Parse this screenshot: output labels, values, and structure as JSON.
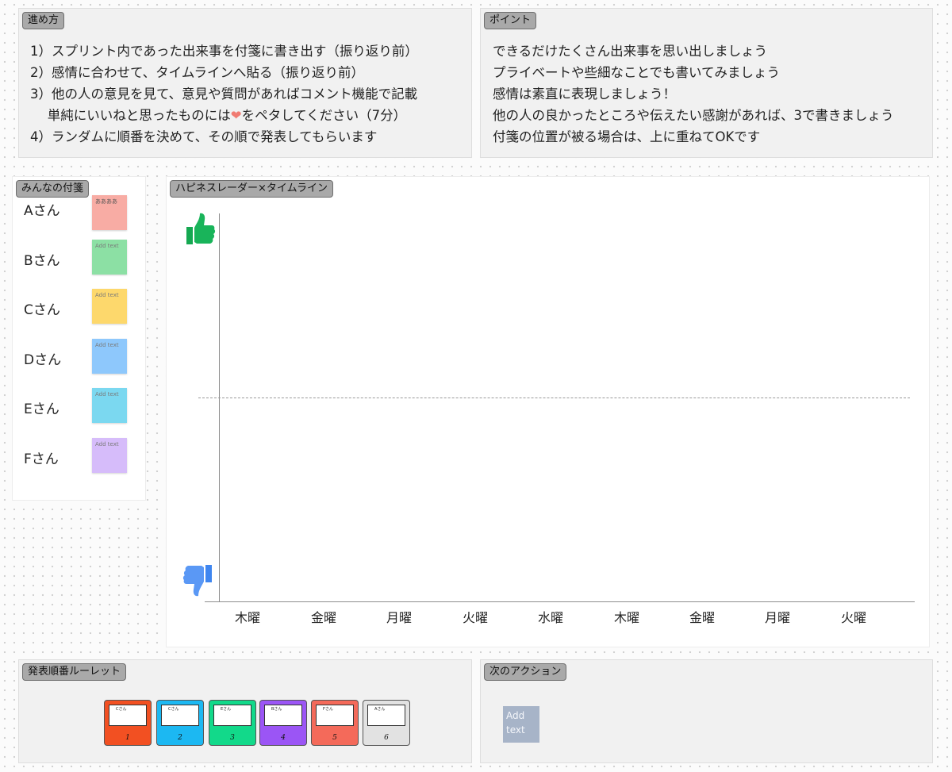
{
  "howto": {
    "tag": "進め方",
    "lines": [
      "1）スプリント内であった出来事を付箋に書き出す（振り返り前）",
      "2）感情に合わせて、タイムラインへ貼る（振り返り前）",
      "3）他の人の意見を見て、意見や質問があればコメント機能で記載"
    ],
    "line4_pre": "　 単純にいいねと思ったものには",
    "line4_heart": "❤",
    "line4_post": "をペタしてください（7分）",
    "line5": "4）ランダムに順番を決めて、その順で発表してもらいます"
  },
  "points": {
    "tag": "ポイント",
    "lines": [
      "できるだけたくさん出来事を思い出しましょう",
      "プライベートや些細なことでも書いてみましょう",
      "感情は素直に表現しましょう！",
      "他の人の良かったところや伝えたい感謝があれば、3で書きましょう",
      "付箋の位置が被る場合は、上に重ねてOKです"
    ]
  },
  "members": {
    "tag": "みんなの付箋",
    "people": [
      {
        "name": "Aさん",
        "note": "ああああ",
        "color": "#f8aca4"
      },
      {
        "name": "Bさん",
        "note": "Add text",
        "color": "#8ce0a4"
      },
      {
        "name": "Cさん",
        "note": "Add text",
        "color": "#fdd86c"
      },
      {
        "name": "Dさん",
        "note": "Add text",
        "color": "#8ec8fc"
      },
      {
        "name": "Eさん",
        "note": "Add text",
        "color": "#7bd8f0"
      },
      {
        "name": "Fさん",
        "note": "Add text",
        "color": "#d6bcfa"
      }
    ]
  },
  "timeline": {
    "tag": "ハピネスレーダー×タイムライン",
    "days": [
      "木曜",
      "金曜",
      "月曜",
      "火曜",
      "水曜",
      "木曜",
      "金曜",
      "月曜",
      "火曜"
    ],
    "good_icon": "thumbs-up-icon",
    "bad_icon": "thumbs-down-icon"
  },
  "roulette": {
    "tag": "発表順番ルーレット",
    "cards": [
      {
        "name": "Cさん",
        "number": "1",
        "color": "#f25022"
      },
      {
        "name": "Cさん",
        "number": "2",
        "color": "#1cb8f2"
      },
      {
        "name": "Eさん",
        "number": "3",
        "color": "#12d98a"
      },
      {
        "name": "Bさん",
        "number": "4",
        "color": "#9b55f5"
      },
      {
        "name": "Fさん",
        "number": "5",
        "color": "#f46a5a"
      },
      {
        "name": "Aさん",
        "number": "6",
        "color": "#e2e2e2"
      }
    ]
  },
  "next_action": {
    "tag": "次のアクション",
    "note": "Add text"
  }
}
